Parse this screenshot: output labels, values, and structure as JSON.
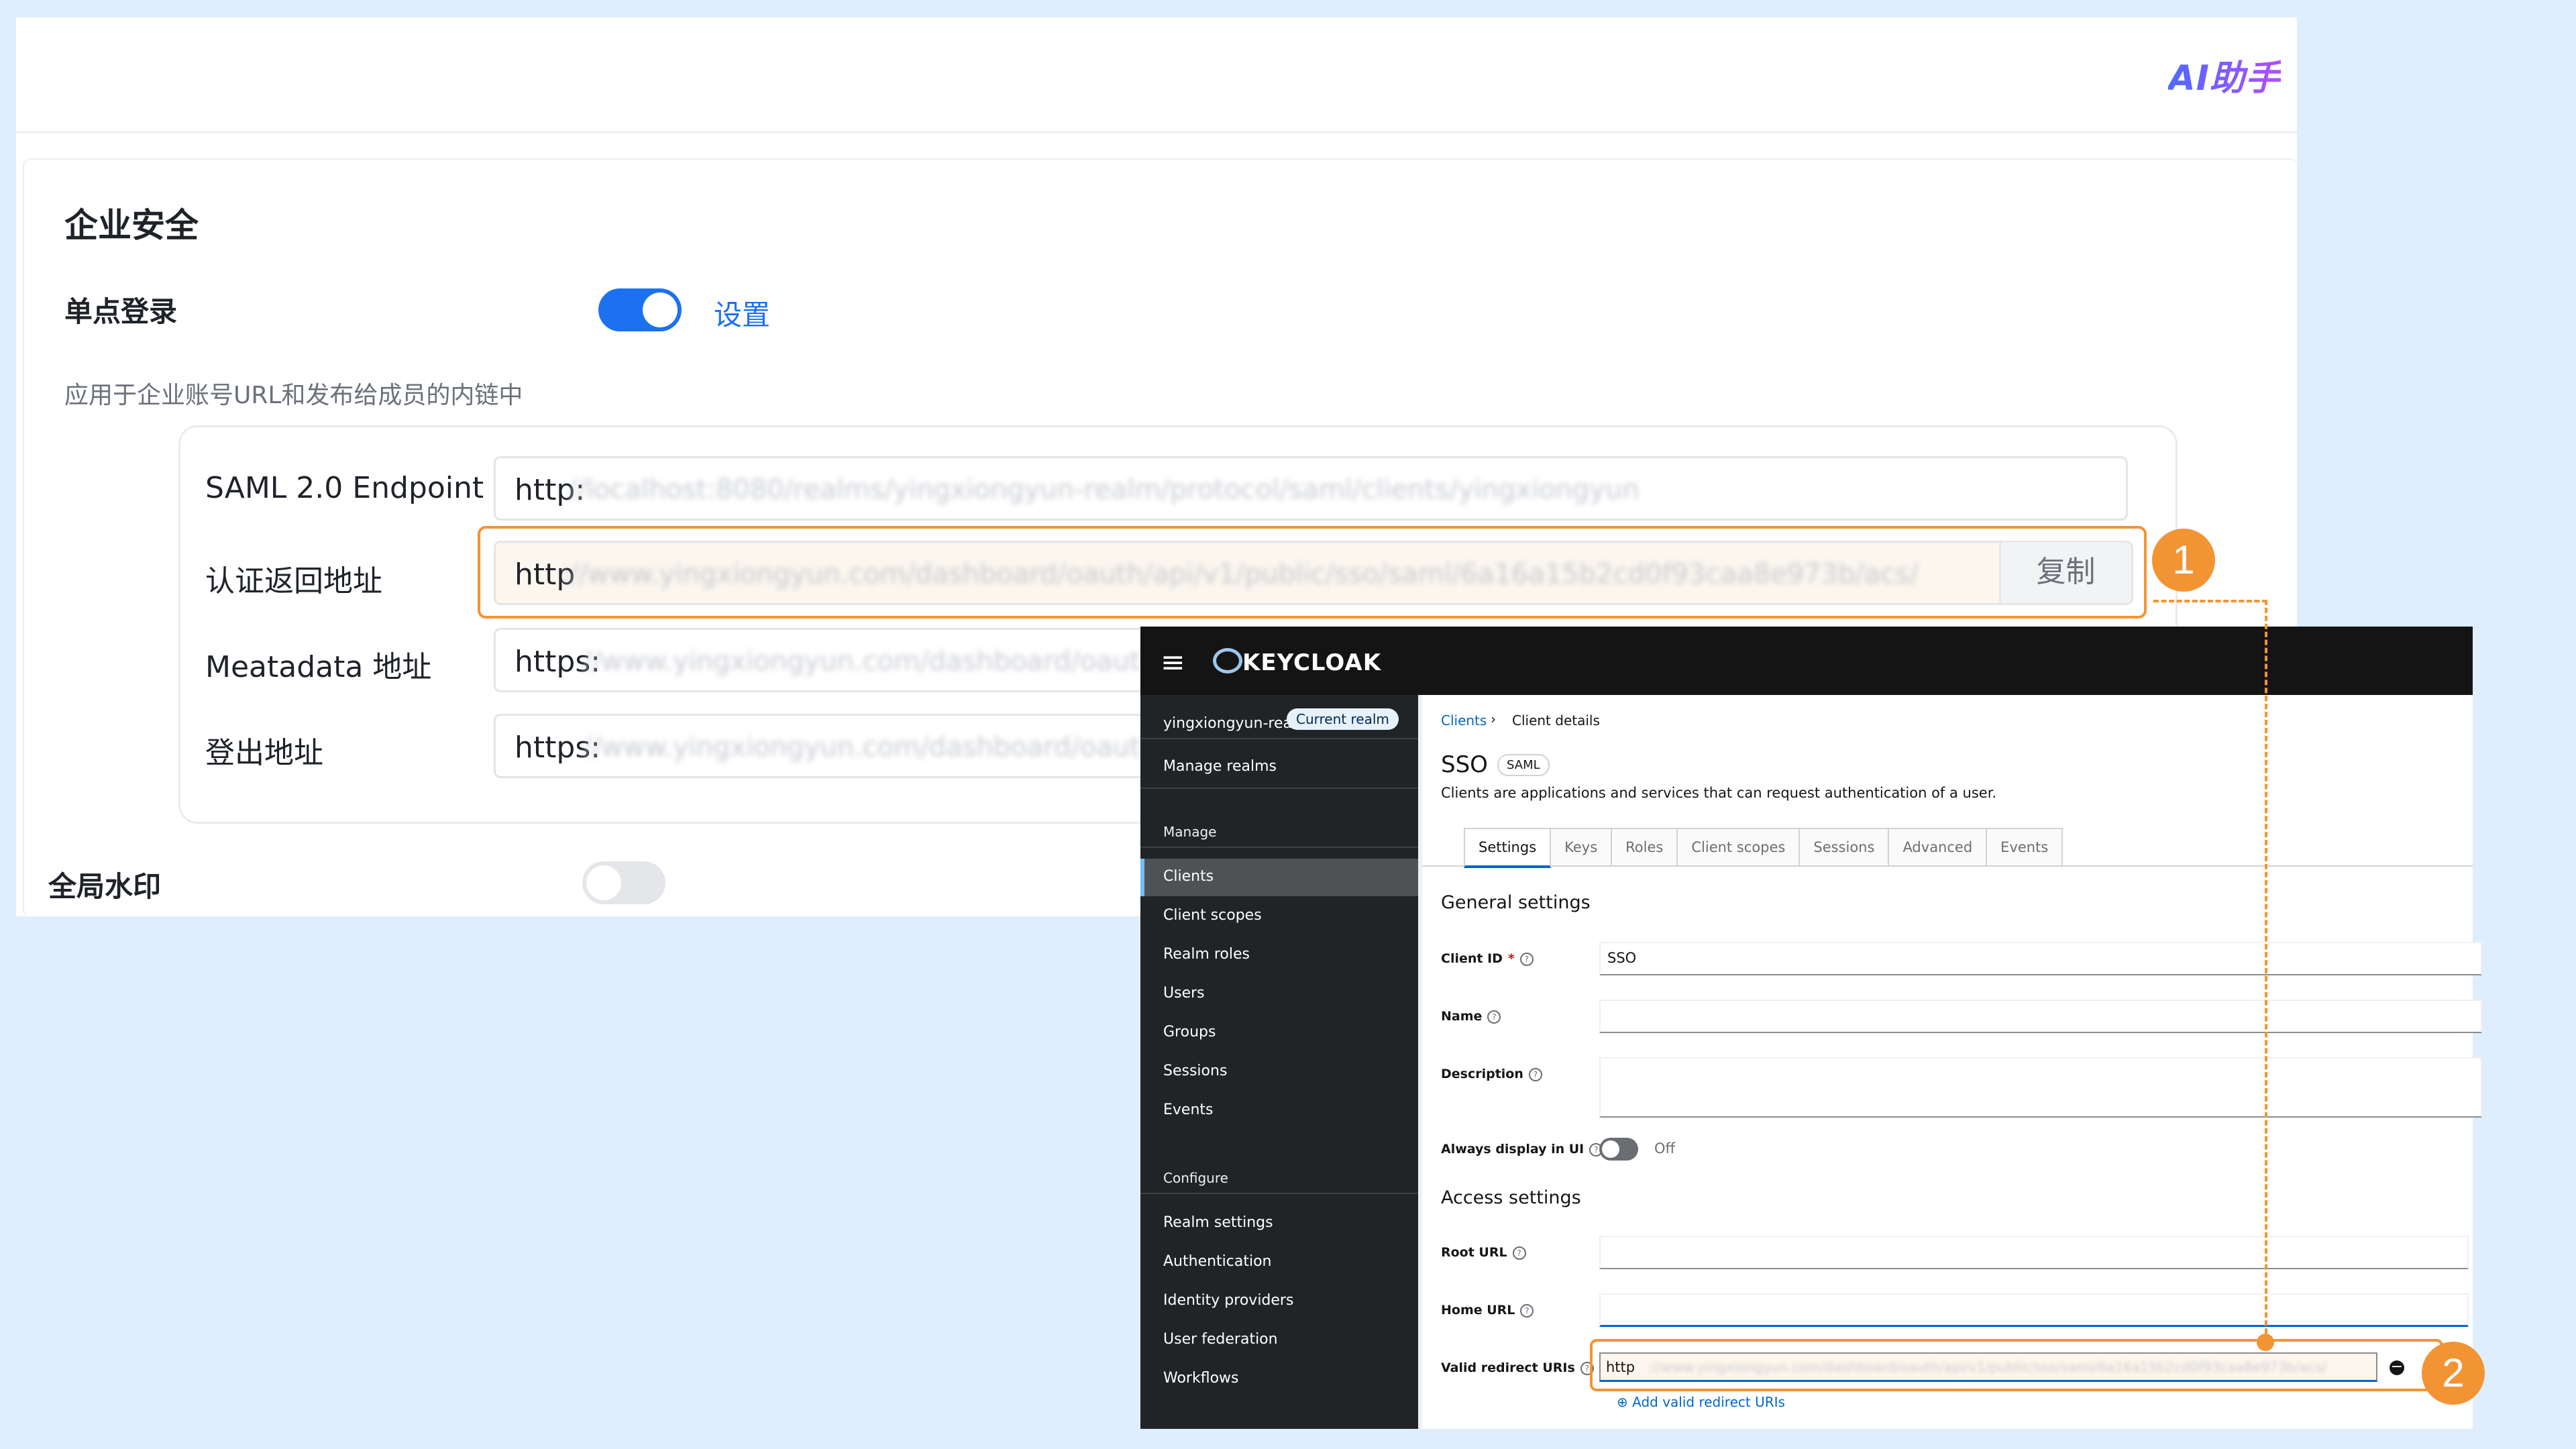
{
  "panel": {
    "logo_text": "AI助手",
    "section_title": "企业安全",
    "sso": {
      "label": "单点登录",
      "enabled": true,
      "setting_link": "设置",
      "description": "应用于企业账号URL和发布给成员的内链中"
    },
    "fields": [
      {
        "label": "SAML 2.0 Endpoint",
        "value": "http:",
        "blurred": "//localhost:8080/realms/yingxiongyun-realm/protocol/saml/clients/yingxiongyun"
      },
      {
        "label": "认证返回地址",
        "value": "http",
        "blurred": "://www.yingxiongyun.com/dashboard/oauth/api/v1/public/sso/saml/6a16a15b2cd0f93caa8e973b/acs/",
        "copy_label": "复制"
      },
      {
        "label": "Meatadata 地址",
        "value": "https:",
        "blurred": "//www.yingxiongyun.com/dashboard/oauth"
      },
      {
        "label": "登出地址",
        "value": "https:",
        "blurred": "//www.yingxiongyun.com/dashboard/oauth"
      }
    ],
    "watermark": {
      "label": "全局水印",
      "enabled": false
    }
  },
  "markers": {
    "one": "1",
    "two": "2"
  },
  "keycloak": {
    "logo": "KEYCLOAK",
    "realm": "yingxiongyun-realm",
    "realm_badge": "Current realm",
    "manage_realms": "Manage realms",
    "section_manage": "Manage",
    "manage_items": [
      "Clients",
      "Client scopes",
      "Realm roles",
      "Users",
      "Groups",
      "Sessions",
      "Events"
    ],
    "section_configure": "Configure",
    "configure_items": [
      "Realm settings",
      "Authentication",
      "Identity providers",
      "User federation",
      "Workflows"
    ],
    "breadcrumb": {
      "clients": "Clients",
      "separator": "›",
      "current": "Client details"
    },
    "title": "SSO",
    "protocol_badge": "SAML",
    "subtitle": "Clients are applications and services that can request authentication of a user.",
    "tabs": [
      "Settings",
      "Keys",
      "Roles",
      "Client scopes",
      "Sessions",
      "Advanced",
      "Events"
    ],
    "general_settings": "General settings",
    "client_id_label": "Client ID",
    "client_id_value": "SSO",
    "name_label": "Name",
    "description_label": "Description",
    "always_display_label": "Always display in UI",
    "always_display_state": "Off",
    "access_settings": "Access settings",
    "root_url_label": "Root URL",
    "home_url_label": "Home URL",
    "valid_redirect_label": "Valid redirect URIs",
    "valid_redirect_value": "http",
    "valid_redirect_blurred": "://www.yingxiongyun.com/dashboard/oauth/api/v1/public/sso/saml/6a16a15b2cd0f93caa8e973b/acs/",
    "add_redirect": "Add valid redirect URIs"
  },
  "colors": {
    "accent": "#1b71f0",
    "highlight": "#f29434",
    "keycloak_link": "#0066cc"
  },
  "icons": [
    "ai-logo",
    "hamburger-icon",
    "keycloak-logo-icon",
    "help-icon",
    "remove-icon",
    "add-icon"
  ]
}
